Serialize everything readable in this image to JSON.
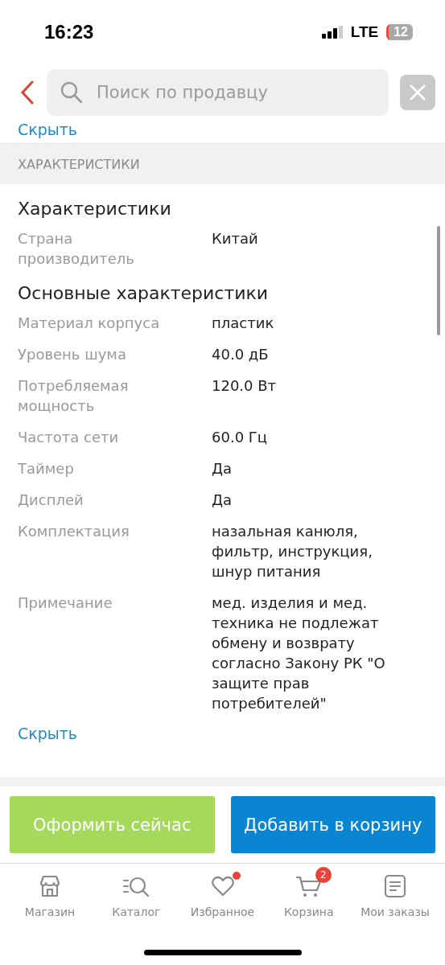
{
  "status_bar": {
    "time": "16:23",
    "network": "LTE",
    "battery": "12"
  },
  "search": {
    "placeholder": "Поиск по продавцу"
  },
  "hide_link_top": "Скрыть",
  "section_title": "ХАРАКТЕРИСТИКИ",
  "groups": [
    {
      "title": "Характеристики",
      "rows": [
        {
          "label": "Страна производитель",
          "value": "Китай"
        }
      ]
    },
    {
      "title": "Основные характеристики",
      "rows": [
        {
          "label": "Материал корпуса",
          "value": "пластик"
        },
        {
          "label": "Уровень шума",
          "value": "40.0 дБ"
        },
        {
          "label": "Потребляемая мощность",
          "value": "120.0 Вт"
        },
        {
          "label": "Частота сети",
          "value": "60.0 Гц"
        },
        {
          "label": "Таймер",
          "value": "Да"
        },
        {
          "label": "Дисплей",
          "value": "Да"
        },
        {
          "label": "Комплектация",
          "value": "назальная канюля, фильтр, инструкция, шнур питания"
        },
        {
          "label": "Примечание",
          "value": "мед. изделия и мед. техника не подлежат обмену и возврату согласно Закону РК \"О защите прав потребителей\""
        }
      ]
    }
  ],
  "hide_link": "Скрыть",
  "actions": [
    {
      "label": "Оформить сейчас",
      "kind": "secondary"
    },
    {
      "label": "Добавить в корзину",
      "kind": "primary"
    }
  ],
  "tab_bar": [
    {
      "label": "Магазин",
      "kind": "store"
    },
    {
      "label": "Каталог",
      "kind": "catalog"
    },
    {
      "label": "Избранное",
      "kind": "heart",
      "dot": true
    },
    {
      "label": "Корзина",
      "kind": "cart",
      "badge": "2"
    },
    {
      "label": "Мои заказы",
      "kind": "orders"
    }
  ]
}
